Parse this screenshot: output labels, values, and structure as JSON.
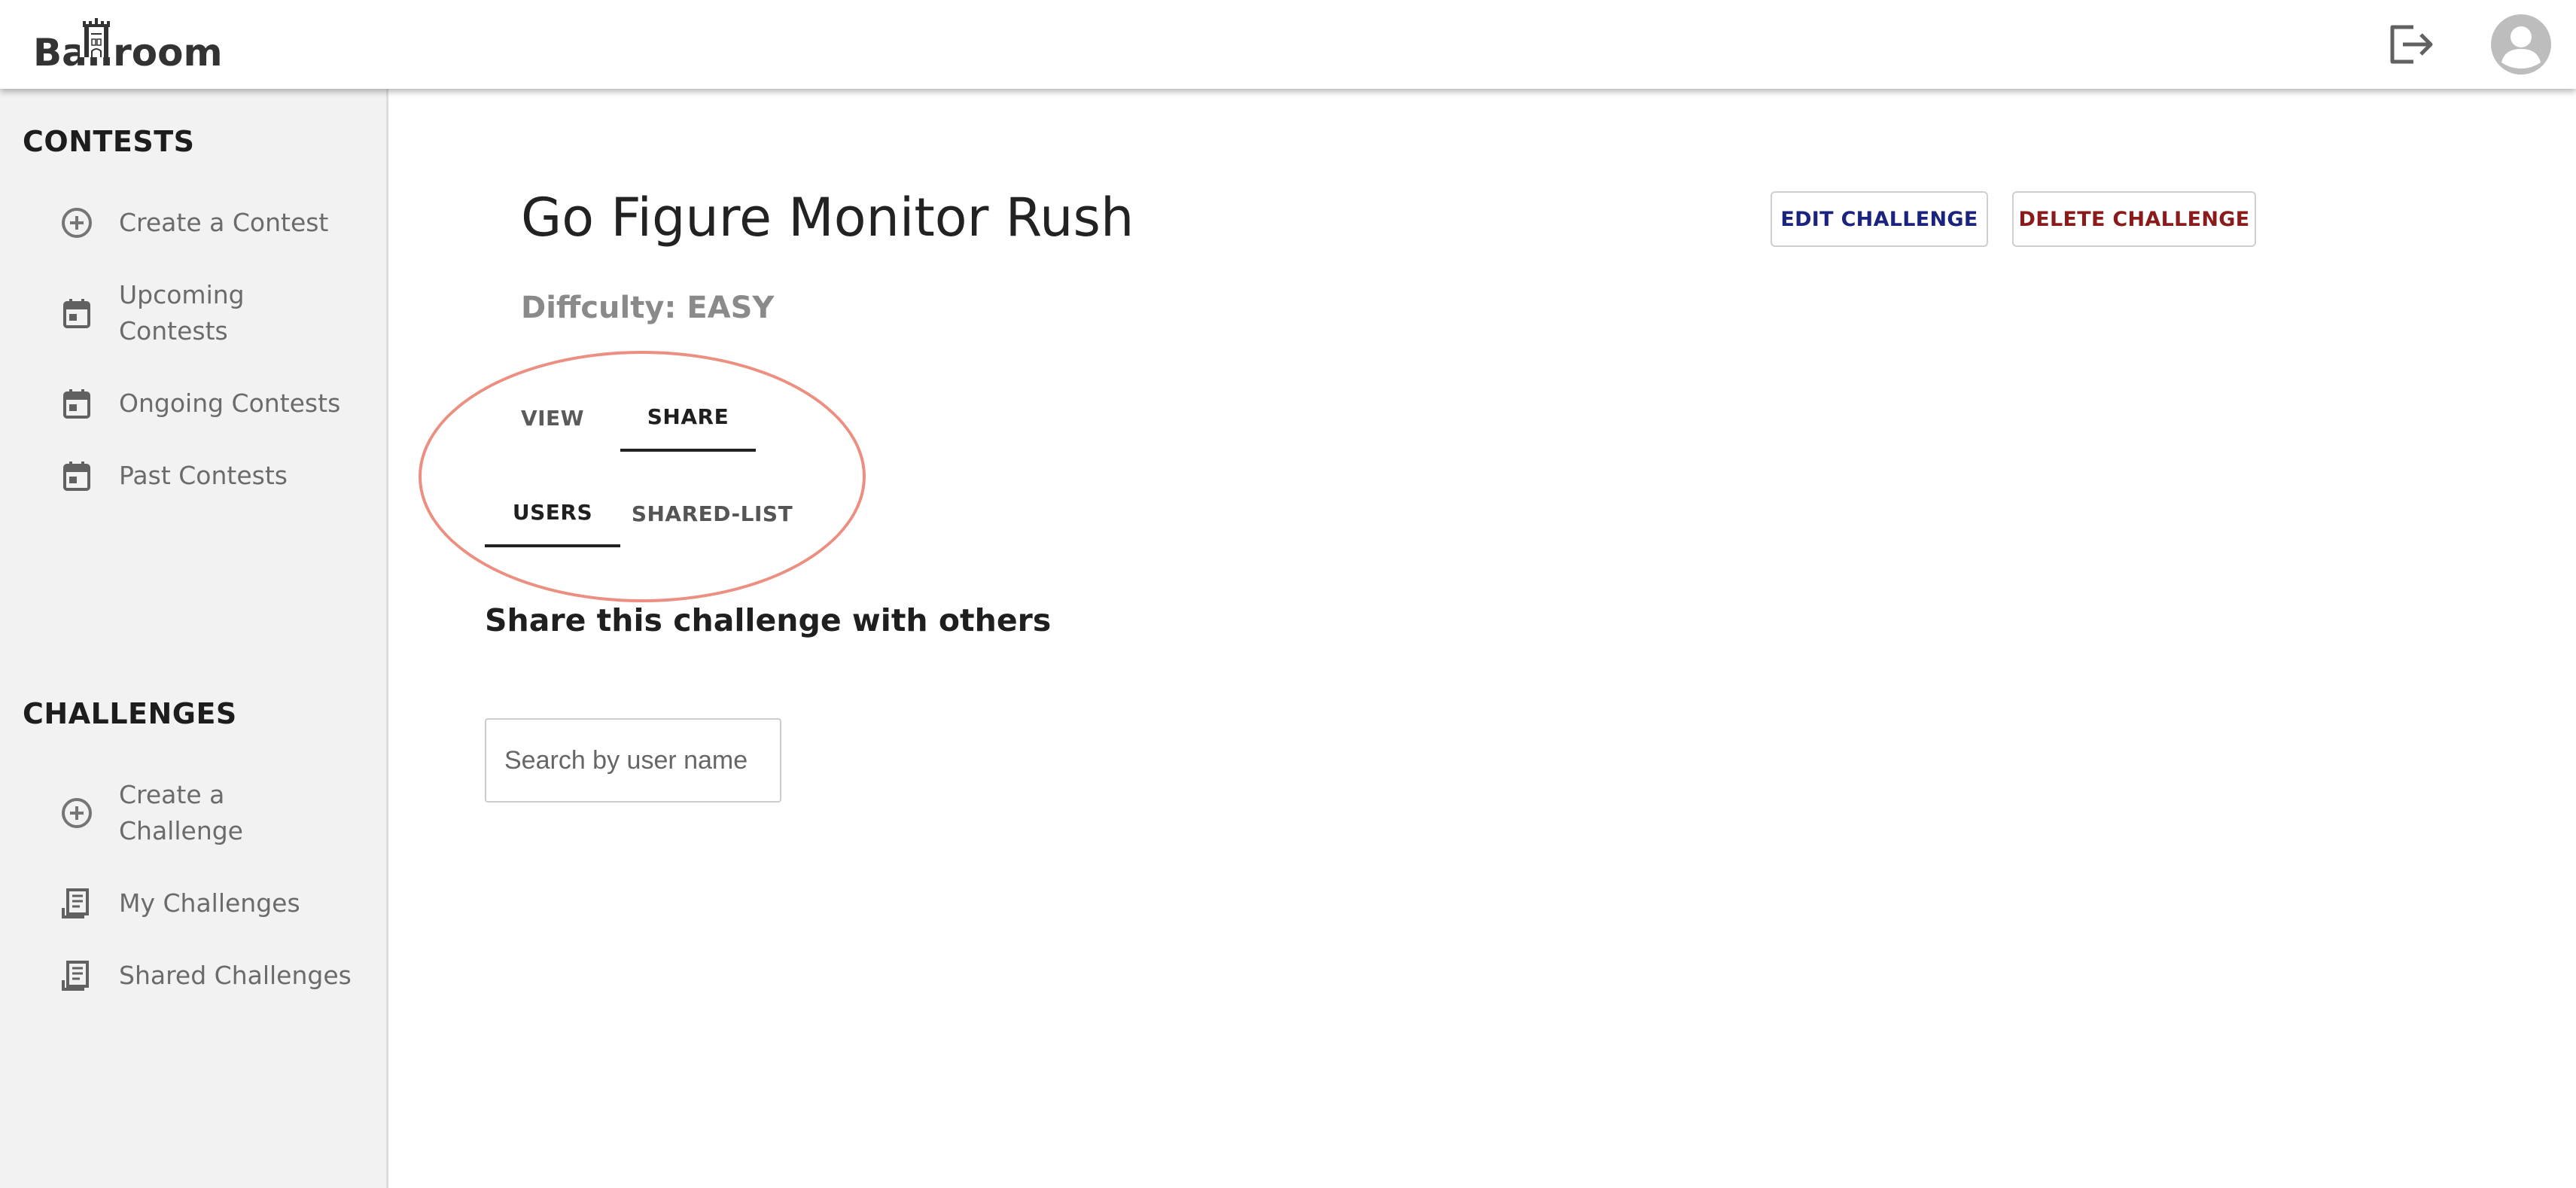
{
  "app": {
    "logo_text": "Ballroom"
  },
  "header": {
    "logout_icon": "logout-icon",
    "avatar_icon": "account-circle-icon"
  },
  "sidebar": {
    "contests_heading": "CONTESTS",
    "contests_items": [
      {
        "label": "Create a Contest",
        "icon": "add-circle-icon"
      },
      {
        "label": "Upcoming Contests",
        "icon": "calendar-icon"
      },
      {
        "label": "Ongoing Contests",
        "icon": "calendar-icon"
      },
      {
        "label": "Past Contests",
        "icon": "calendar-icon"
      }
    ],
    "challenges_heading": "CHALLENGES",
    "challenges_items": [
      {
        "label": "Create a Challenge",
        "icon": "add-circle-icon"
      },
      {
        "label": "My Challenges",
        "icon": "receipt-icon"
      },
      {
        "label": "Shared Challenges",
        "icon": "receipt-icon"
      }
    ]
  },
  "main": {
    "title": "Go Figure Monitor Rush",
    "difficulty": "Diffculty: EASY",
    "edit_button": "EDIT CHALLENGE",
    "delete_button": "DELETE CHALLENGE",
    "tabs": [
      {
        "label": "VIEW",
        "active": false
      },
      {
        "label": "SHARE",
        "active": true
      }
    ],
    "subtabs": [
      {
        "label": "USERS",
        "active": true
      },
      {
        "label": "SHARED-LIST",
        "active": false
      }
    ],
    "share_heading": "Share this challenge with others",
    "search_placeholder": "Search by user name"
  },
  "colors": {
    "edit_button_text": "#1a237e",
    "delete_button_text": "#8b1a1a",
    "highlight_oval": "#ec8e80",
    "sidebar_bg": "#f2f2f2"
  }
}
